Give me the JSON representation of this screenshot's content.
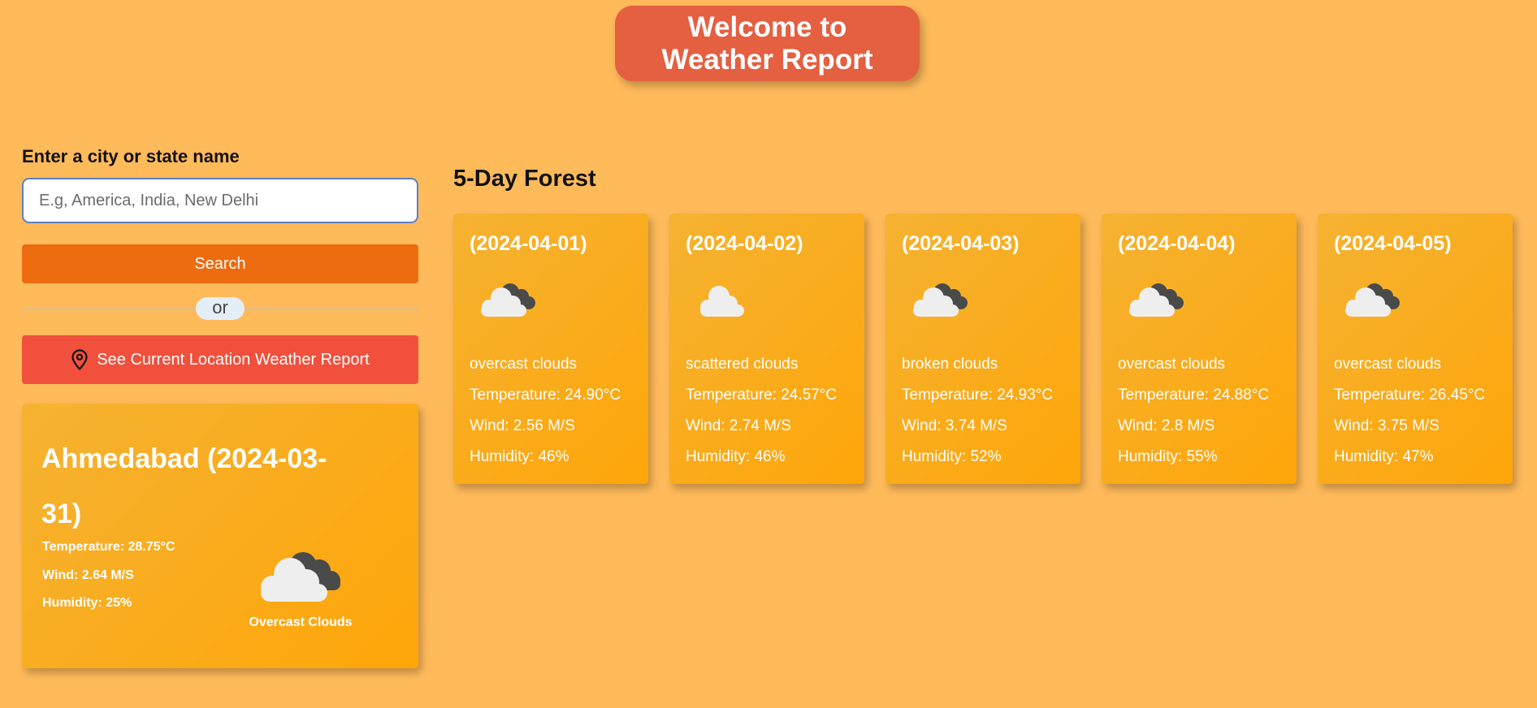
{
  "header": {
    "title_line1": "Welcome to",
    "title_line2": "Weather Report"
  },
  "search": {
    "label": "Enter a city or state name",
    "placeholder": "E.g, America, India, New Delhi",
    "value": "",
    "button_label": "Search",
    "divider_text": "or",
    "location_button_label": "See Current Location Weather Report",
    "location_icon": "map-pin-icon"
  },
  "current": {
    "title": "Ahmedabad (2024-03-31)",
    "temperature": "Temperature: 28.75°C",
    "wind": "Wind: 2.64 M/S",
    "humidity": "Humidity: 25%",
    "condition": "Overcast Clouds",
    "icon": "overcast-clouds-icon"
  },
  "forecast": {
    "title": "5-Day Forest",
    "days": [
      {
        "date": "(2024-04-01)",
        "icon": "overcast-clouds-icon",
        "description": "overcast clouds",
        "temperature": "Temperature: 24.90°C",
        "wind": "Wind: 2.56 M/S",
        "humidity": "Humidity: 46%"
      },
      {
        "date": "(2024-04-02)",
        "icon": "scattered-clouds-icon",
        "description": "scattered clouds",
        "temperature": "Temperature: 24.57°C",
        "wind": "Wind: 2.74 M/S",
        "humidity": "Humidity: 46%"
      },
      {
        "date": "(2024-04-03)",
        "icon": "broken-clouds-icon",
        "description": "broken clouds",
        "temperature": "Temperature: 24.93°C",
        "wind": "Wind: 3.74 M/S",
        "humidity": "Humidity: 52%"
      },
      {
        "date": "(2024-04-04)",
        "icon": "overcast-clouds-icon",
        "description": "overcast clouds",
        "temperature": "Temperature: 24.88°C",
        "wind": "Wind: 2.8 M/S",
        "humidity": "Humidity: 55%"
      },
      {
        "date": "(2024-04-05)",
        "icon": "overcast-clouds-icon",
        "description": "overcast clouds",
        "temperature": "Temperature: 26.45°C",
        "wind": "Wind: 3.75 M/S",
        "humidity": "Humidity: 47%"
      }
    ]
  },
  "colors": {
    "background": "#ffba5a",
    "banner": "#e55f41",
    "search_button": "#ec6c0f",
    "location_button": "#f0503c",
    "card": "#fea609"
  }
}
